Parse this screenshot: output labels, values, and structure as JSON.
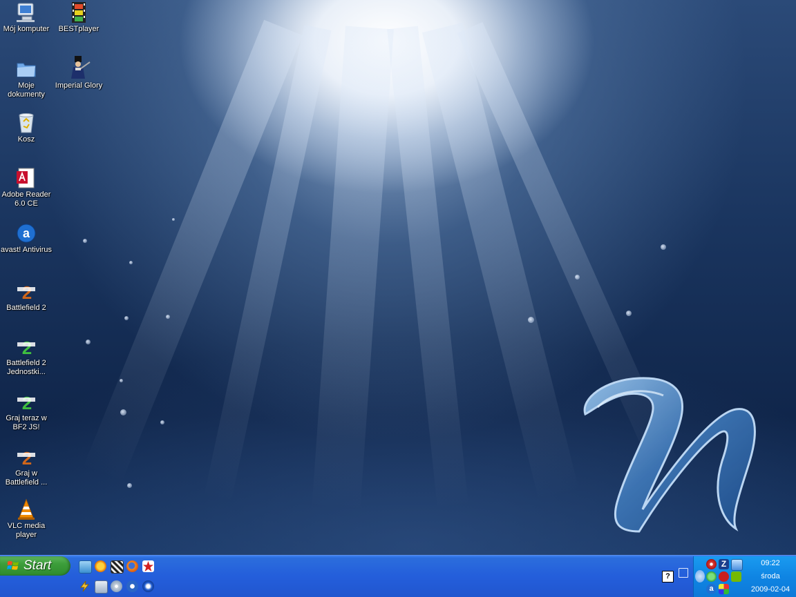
{
  "desktop": {
    "icons": [
      {
        "label": "Mój komputer",
        "icon": "my-computer-icon"
      },
      {
        "label": "BESTplayer",
        "icon": "film-strip-icon"
      },
      {
        "label": "Moje dokumenty",
        "icon": "folder-icon"
      },
      {
        "label": "Imperial Glory",
        "icon": "soldier-game-icon"
      },
      {
        "label": "Kosz",
        "icon": "recycle-bin-icon"
      },
      {
        "label": "Adobe Reader 6.0 CE",
        "icon": "adobe-reader-icon"
      },
      {
        "label": "avast! Antivirus",
        "icon": "avast-icon"
      },
      {
        "label": "Battlefield 2",
        "icon": "battlefield2-icon"
      },
      {
        "label": "Battlefield 2 Jednostki...",
        "icon": "battlefield2-special-forces-icon"
      },
      {
        "label": "Graj teraz w BF2 JS!",
        "icon": "battlefield2-special-forces-icon"
      },
      {
        "label": "Graj w Battlefield ...",
        "icon": "battlefield2-icon"
      },
      {
        "label": "VLC media player",
        "icon": "vlc-cone-icon"
      }
    ]
  },
  "taskbar": {
    "start_label": "Start",
    "quick_launch": [
      "show-desktop-icon",
      "sun-icon",
      "clapperboard-icon",
      "firefox-icon",
      "red-star-icon",
      "lightning-icon",
      "people-icon",
      "cd-icon",
      "media-icon",
      "blue-swirl-icon"
    ],
    "tray": {
      "time": "09:22",
      "day": "środa",
      "date": "2009-02-04",
      "icons": [
        "gear-tray-icon",
        "zonealarm-icon",
        "network-icon",
        "help-icon",
        "restore-icon",
        "chevron-left-icon",
        "messenger-icon",
        "flash-icon",
        "nvidia-icon",
        "avast-tray-icon",
        "grid-icon"
      ]
    }
  },
  "colors": {
    "taskbar": "#245edb",
    "start": "#3c9d3a",
    "tray": "#0f85e3"
  }
}
